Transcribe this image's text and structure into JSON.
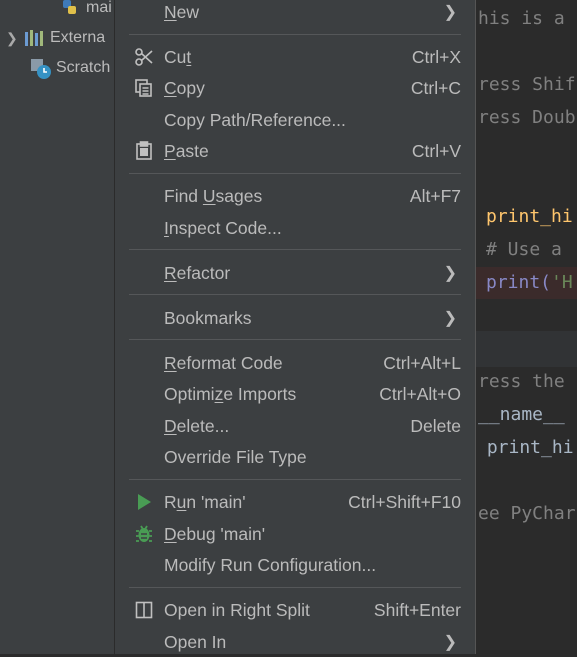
{
  "tree": {
    "main_file": "mai",
    "external": "Externa",
    "scratches": "Scratch"
  },
  "menu": {
    "items": [
      {
        "pre": "",
        "ul": "N",
        "post": "ew",
        "shortcut": "",
        "submenu": true
      },
      {
        "pre": "Cu",
        "ul": "t",
        "post": "",
        "shortcut": "Ctrl+X",
        "icon": "scissors-icon"
      },
      {
        "pre": "",
        "ul": "C",
        "post": "opy",
        "shortcut": "Ctrl+C",
        "icon": "copy-icon"
      },
      {
        "pre": "Copy Path/Reference...",
        "ul": "",
        "post": "",
        "shortcut": ""
      },
      {
        "pre": "",
        "ul": "P",
        "post": "aste",
        "shortcut": "Ctrl+V",
        "icon": "clipboard-icon"
      },
      {
        "pre": "Find ",
        "ul": "U",
        "post": "sages",
        "shortcut": "Alt+F7"
      },
      {
        "pre": "",
        "ul": "I",
        "post": "nspect Code...",
        "shortcut": ""
      },
      {
        "pre": "",
        "ul": "R",
        "post": "efactor",
        "shortcut": "",
        "submenu": true
      },
      {
        "pre": "Bookmarks",
        "ul": "",
        "post": "",
        "shortcut": "",
        "submenu": true
      },
      {
        "pre": "",
        "ul": "R",
        "post": "eformat Code",
        "shortcut": "Ctrl+Alt+L"
      },
      {
        "pre": "Optimi",
        "ul": "z",
        "post": "e Imports",
        "shortcut": "Ctrl+Alt+O"
      },
      {
        "pre": "",
        "ul": "D",
        "post": "elete...",
        "shortcut": "Delete"
      },
      {
        "pre": "Override File Type",
        "ul": "",
        "post": "",
        "shortcut": ""
      },
      {
        "pre": "R",
        "ul": "u",
        "post": "n 'main'",
        "shortcut": "Ctrl+Shift+F10",
        "icon": "run-icon"
      },
      {
        "pre": "",
        "ul": "D",
        "post": "ebug 'main'",
        "shortcut": "",
        "icon": "debug-icon"
      },
      {
        "pre": "Modify Run Configuration...",
        "ul": "",
        "post": "",
        "shortcut": ""
      },
      {
        "pre": "Open in Right Split",
        "ul": "",
        "post": "",
        "shortcut": "Shift+Enter",
        "icon": "split-icon"
      },
      {
        "pre": "Open In",
        "ul": "",
        "post": "",
        "shortcut": "",
        "submenu": true
      }
    ]
  },
  "editor": {
    "lines": [
      "his is a",
      "ress Shif",
      "ress Doub",
      "print_hi",
      "# Use a",
      "print('H",
      "ress the",
      "__name__",
      " print_hi",
      "ee PyChar"
    ]
  }
}
